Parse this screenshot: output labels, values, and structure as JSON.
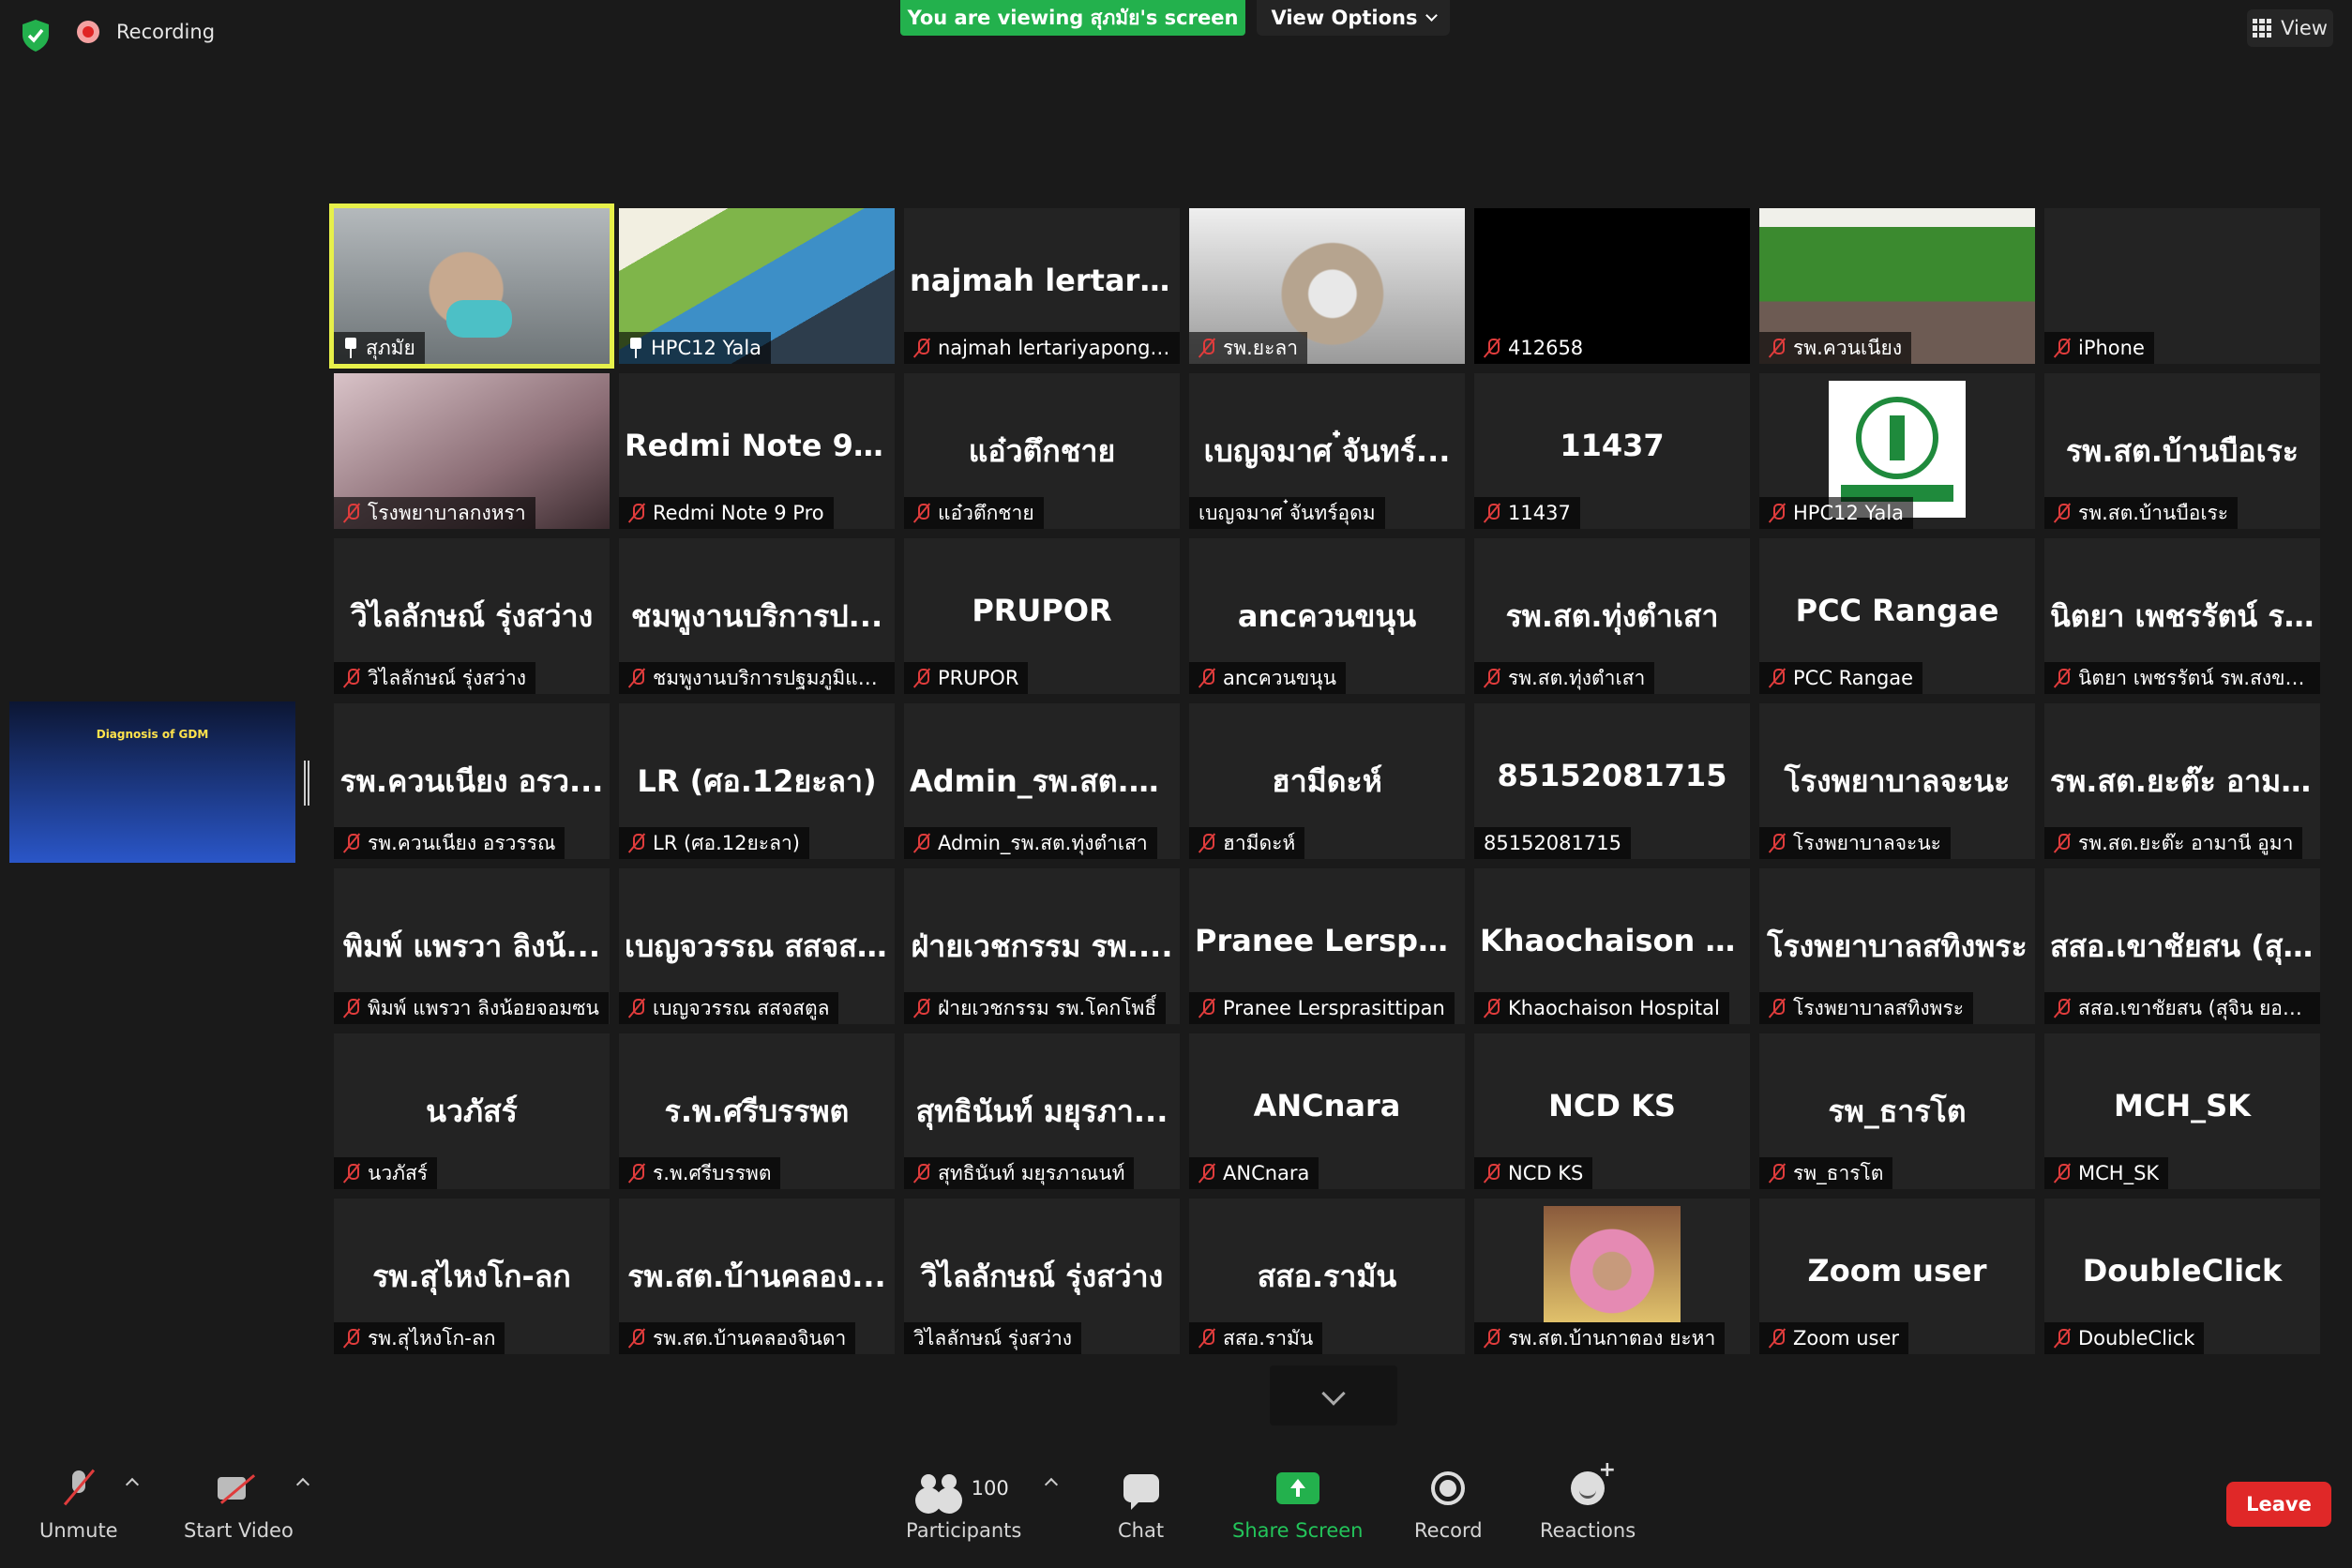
{
  "topbar": {
    "recording_label": "Recording",
    "viewing_banner": "You are viewing สุภมัย's screen",
    "view_options_label": "View Options",
    "view_label": "View"
  },
  "shared_screen": {
    "title": "Diagnosis of GDM"
  },
  "tiles": [
    {
      "name": "",
      "label": "สุภมัย",
      "icon": "pin",
      "video": "face1",
      "active": true
    },
    {
      "name": "",
      "label": "HPC12 Yala",
      "icon": "pin",
      "video": "paint"
    },
    {
      "name": "najmah lertariya...",
      "label": "najmah lertariyapongkul",
      "icon": "mic-muted"
    },
    {
      "name": "",
      "label": "รพ.ยะลา",
      "icon": "mic-muted",
      "video": "mask2"
    },
    {
      "name": "",
      "label": "412658",
      "icon": "mic-muted",
      "video": "black"
    },
    {
      "name": "",
      "label": "รพ.ควนเนียง",
      "icon": "mic-muted",
      "video": "board"
    },
    {
      "name": "",
      "label": "iPhone",
      "icon": "mic-muted"
    },
    {
      "name": "",
      "label": "โรงพยาบาลกงหรา",
      "icon": "mic-muted",
      "video": "hand"
    },
    {
      "name": "Redmi Note 9 Pro",
      "label": "Redmi Note 9 Pro",
      "icon": "mic-muted"
    },
    {
      "name": "แอ๋วตึกชาย",
      "label": "แอ๋วตึกชาย",
      "icon": "mic-muted"
    },
    {
      "name": "เบญจมาศ ๋จันทร์...",
      "label": "เบญจมาศ ๋จันทร์อุดม",
      "icon": "none"
    },
    {
      "name": "11437",
      "label": "11437",
      "icon": "mic-muted"
    },
    {
      "name": "",
      "label": "HPC12 Yala",
      "icon": "mic-muted",
      "video": "logo"
    },
    {
      "name": "รพ.สต.บ้านบือเระ",
      "label": "รพ.สต.บ้านบือเระ",
      "icon": "mic-muted"
    },
    {
      "name": "วิไลลักษณ์   รุ่งสว่าง",
      "label": "วิไลลักษณ์   รุ่งสว่าง",
      "icon": "mic-muted"
    },
    {
      "name": "ชมพูงานบริการป...",
      "label": "ชมพูงานบริการปฐมภูมิและอ...",
      "icon": "mic-muted"
    },
    {
      "name": "PRUPOR",
      "label": "PRUPOR",
      "icon": "mic-muted"
    },
    {
      "name": "ancควนขนุน",
      "label": "ancควนขนุน",
      "icon": "mic-muted"
    },
    {
      "name": "รพ.สต.ทุ่งตำเสา",
      "label": "รพ.สต.ทุ่งตำเสา",
      "icon": "mic-muted"
    },
    {
      "name": "PCC Rangae",
      "label": "PCC Rangae",
      "icon": "mic-muted"
    },
    {
      "name": "นิตยา เพชรรัตน์ ร...",
      "label": "นิตยา เพชรรัตน์ รพ.สงขลา ...",
      "icon": "mic-muted"
    },
    {
      "name": "รพ.ควนเนียง อรว...",
      "label": "รพ.ควนเนียง อรวรรณ",
      "icon": "mic-muted"
    },
    {
      "name": "LR (ศอ.12ยะลา)",
      "label": "LR (ศอ.12ยะลา)",
      "icon": "mic-muted"
    },
    {
      "name": "Admin_รพ.สต.ทุ่...",
      "label": "Admin_รพ.สต.ทุ่งตำเสา",
      "icon": "mic-muted"
    },
    {
      "name": "ฮามีดะห์",
      "label": "ฮามีดะห์",
      "icon": "mic-muted"
    },
    {
      "name": "85152081715",
      "label": "85152081715",
      "icon": "none"
    },
    {
      "name": "โรงพยาบาลจะนะ",
      "label": "โรงพยาบาลจะนะ",
      "icon": "mic-muted"
    },
    {
      "name": "รพ.สต.ยะต๊ะ อาม...",
      "label": "รพ.สต.ยะต๊ะ อามานี อูมา",
      "icon": "mic-muted"
    },
    {
      "name": "พิมพ์ แพรวา ลิงน้...",
      "label": "พิมพ์ แพรวา ลิงน้อยจอมซน",
      "icon": "mic-muted"
    },
    {
      "name": "เบญจวรรณ สสจส...",
      "label": "เบญจวรรณ สสจสตูล",
      "icon": "mic-muted"
    },
    {
      "name": "ฝ่ายเวชกรรม รพ....",
      "label": "ฝ่ายเวชกรรม รพ.โคกโพธิ์",
      "icon": "mic-muted"
    },
    {
      "name": "Pranee  Lersprasi...",
      "label": "Pranee Lersprasittipan",
      "icon": "mic-muted"
    },
    {
      "name": "Khaochaison  Ho...",
      "label": "Khaochaison Hospital",
      "icon": "mic-muted"
    },
    {
      "name": "โรงพยาบาลสทิงพระ",
      "label": "โรงพยาบาลสทิงพระ",
      "icon": "mic-muted"
    },
    {
      "name": "สสอ.เขาชัยสน (สุ...",
      "label": "สสอ.เขาชัยสน (สุจิน ยอดตร...",
      "icon": "mic-muted"
    },
    {
      "name": "นวภัสร์",
      "label": "นวภัสร์",
      "icon": "mic-muted"
    },
    {
      "name": "ร.พ.ศรีบรรพต",
      "label": "ร.พ.ศรีบรรพต",
      "icon": "mic-muted"
    },
    {
      "name": "สุทธินันท์ มยุรภา...",
      "label": "สุทธินันท์ มยุรภาณนท์",
      "icon": "mic-muted"
    },
    {
      "name": "ANCnara",
      "label": "ANCnara",
      "icon": "mic-muted"
    },
    {
      "name": "NCD KS",
      "label": "NCD KS",
      "icon": "mic-muted"
    },
    {
      "name": "รพ_ธารโต",
      "label": "รพ_ธารโต",
      "icon": "mic-muted"
    },
    {
      "name": "MCH_SK",
      "label": "MCH_SK",
      "icon": "mic-muted"
    },
    {
      "name": "รพ.สุไหงโก-ลก",
      "label": "รพ.สุไหงโก-ลก",
      "icon": "mic-muted"
    },
    {
      "name": "รพ.สต.บ้านคลอง...",
      "label": "รพ.สต.บ้านคลองจินดา",
      "icon": "mic-muted"
    },
    {
      "name": "วิไลลักษณ์   รุ่งสว่าง",
      "label": "วิไลลักษณ์   รุ่งสว่าง",
      "icon": "none"
    },
    {
      "name": "สสอ.รามัน",
      "label": "สสอ.รามัน",
      "icon": "mic-muted"
    },
    {
      "name": "",
      "label": "รพ.สต.บ้านกาตอง ยะหา",
      "icon": "mic-muted",
      "video": "portrait"
    },
    {
      "name": "Zoom user",
      "label": "Zoom user",
      "icon": "mic-muted"
    },
    {
      "name": "DoubleClick",
      "label": "DoubleClick",
      "icon": "mic-muted"
    }
  ],
  "toolbar": {
    "unmute_label": "Unmute",
    "start_video_label": "Start Video",
    "participants_label": "Participants",
    "participants_count": "100",
    "chat_label": "Chat",
    "share_screen_label": "Share Screen",
    "record_label": "Record",
    "reactions_label": "Reactions",
    "leave_label": "Leave"
  },
  "colors": {
    "share_green": "#23b14d",
    "leave_red": "#e02828",
    "active_speaker": "#e7f04a",
    "muted_red": "#e03c3c"
  }
}
